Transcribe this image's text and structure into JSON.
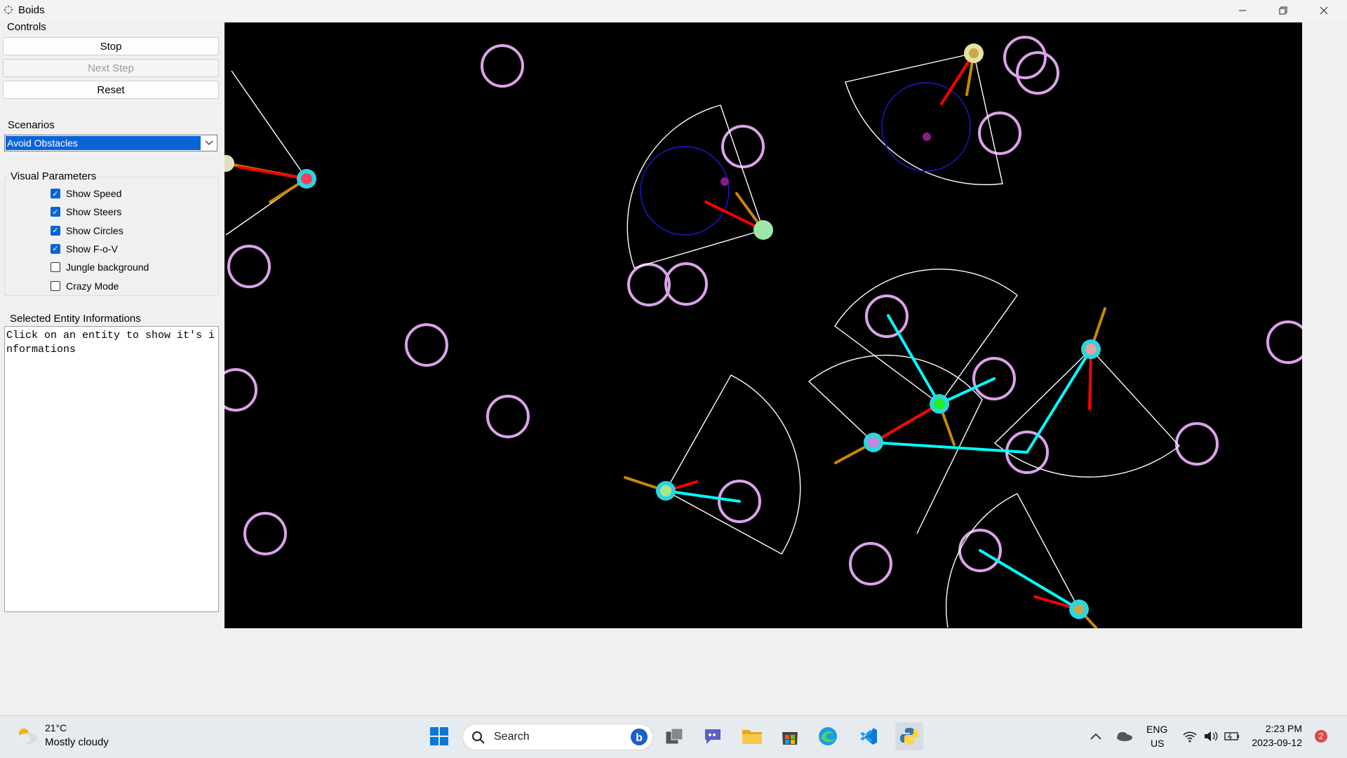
{
  "window": {
    "title": "Boids"
  },
  "controls": {
    "group_label": "Controls",
    "stop_label": "Stop",
    "next_step_label": "Next Step",
    "reset_label": "Reset"
  },
  "scenarios": {
    "group_label": "Scenarios",
    "selected": "Avoid Obstacles"
  },
  "visual_parameters": {
    "group_label": "Visual Parameters",
    "items": [
      {
        "label": "Show Speed",
        "checked": true
      },
      {
        "label": "Show Steers",
        "checked": true
      },
      {
        "label": "Show Circles",
        "checked": true
      },
      {
        "label": "Show F-o-V",
        "checked": true
      },
      {
        "label": "Jungle background",
        "checked": false
      },
      {
        "label": "Crazy Mode",
        "checked": false
      }
    ]
  },
  "entity_info": {
    "group_label": "Selected Entity Informations",
    "text": "Click on an entity to show it's informations"
  },
  "taskbar": {
    "weather_temp": "21°C",
    "weather_desc": "Mostly cloudy",
    "search_label": "Search",
    "lang_1": "ENG",
    "lang_2": "US",
    "time": "2:23 PM",
    "date": "2023-09-12",
    "notification_count": "2"
  },
  "colors": {
    "obstacle": "#d9a3e8",
    "speed": "#c8860a",
    "steer": "#ff0000",
    "neighbor_line": "#00ffff",
    "fov": "#ffffff",
    "accent": "#0a64d8"
  }
}
